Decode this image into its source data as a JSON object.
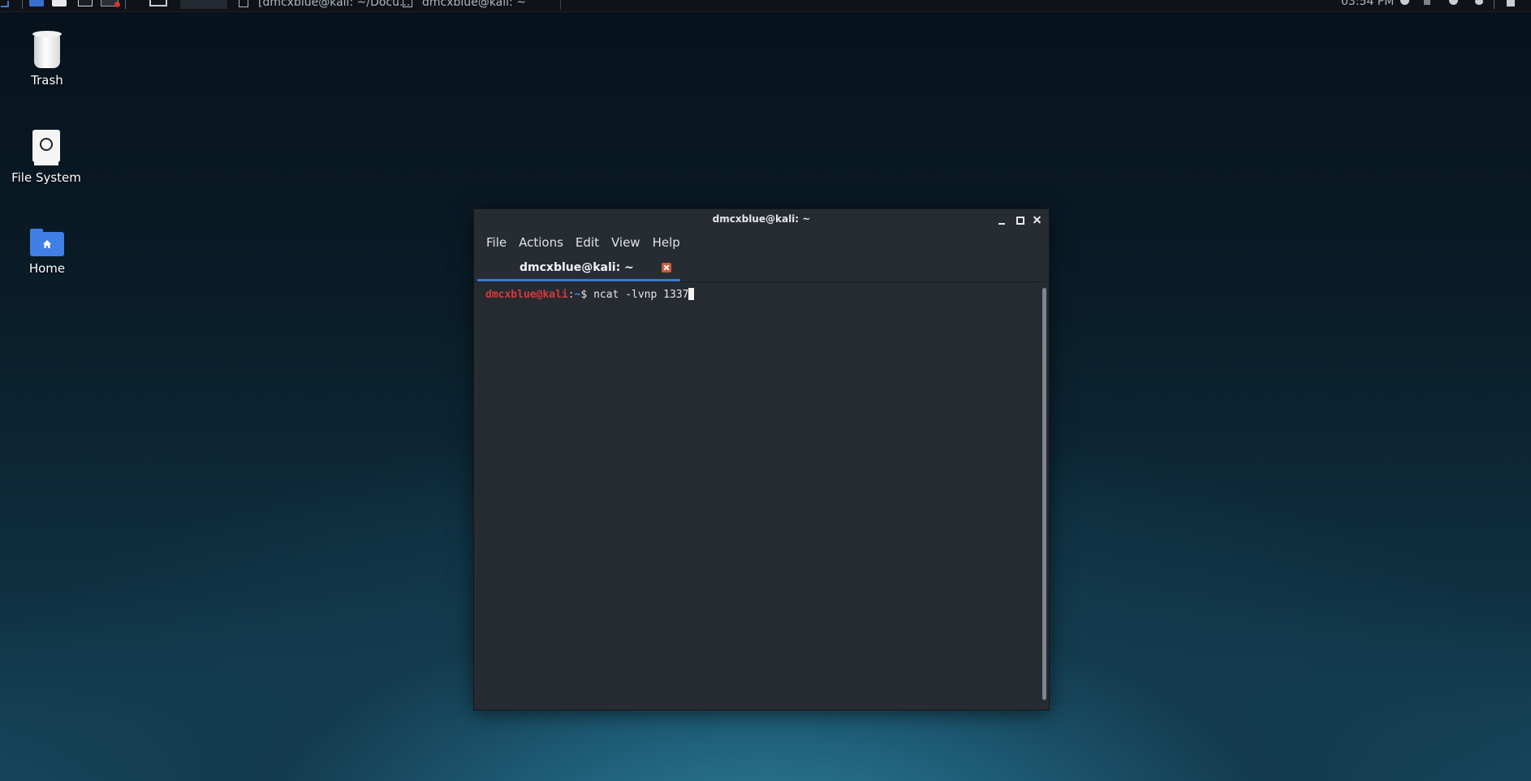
{
  "top_panel": {
    "tasks": [
      {
        "label": "[dmcxblue@kali: ~/Docu..."
      },
      {
        "label": "dmcxblue@kali: ~"
      }
    ],
    "clock": "03:54 PM"
  },
  "desktop": {
    "icons": [
      {
        "label": "Trash",
        "icon": "trash-icon"
      },
      {
        "label": "File System",
        "icon": "drive-icon"
      },
      {
        "label": "Home",
        "icon": "home-folder-icon"
      }
    ]
  },
  "window": {
    "title": "dmcxblue@kali: ~",
    "menu": [
      "File",
      "Actions",
      "Edit",
      "View",
      "Help"
    ],
    "tab": {
      "label": "dmcxblue@kali: ~"
    },
    "terminal": {
      "prompt_user": "dmcxblue@kali",
      "prompt_colon": ":",
      "prompt_path": "~",
      "prompt_symbol": "$ ",
      "command": "ncat -lvnp 1337"
    }
  },
  "colors": {
    "accent": "#3a7bd5",
    "prompt_user": "#d63a3a",
    "prompt_path": "#3b8eea",
    "tab_close": "#c85a3c"
  }
}
